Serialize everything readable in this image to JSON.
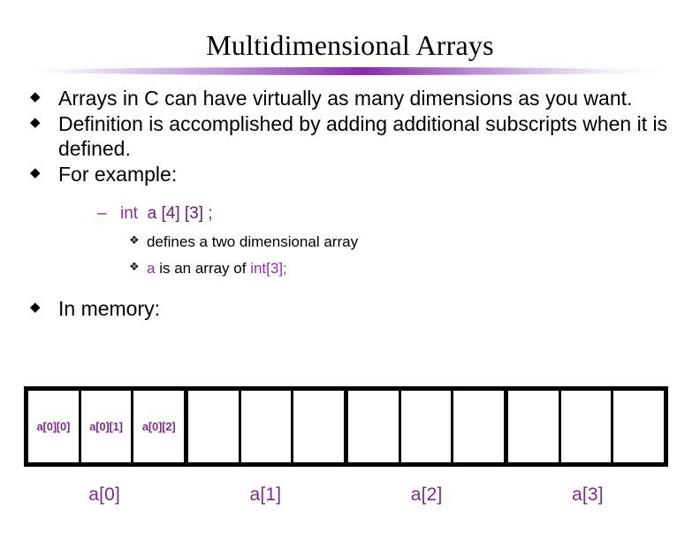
{
  "slide": {
    "title": "Multidimensional Arrays",
    "bullet_marker": "◆",
    "dash_marker": "–",
    "diamond_marker": "❖"
  },
  "bullets": [
    {
      "text": "Arrays in C can have virtually as many dimensions as you want."
    },
    {
      "text": "Definition is accomplished by adding additional subscripts when it is defined."
    },
    {
      "text": "For example:"
    }
  ],
  "code_line": {
    "keyword": "int",
    "expression": "a [4] [3] ;"
  },
  "sub_points": [
    {
      "prefix": "",
      "emphasis": "",
      "text": "defines a two dimensional array",
      "suffix": ""
    },
    {
      "prefix": "",
      "emphasis": "a",
      "text": " is an array of ",
      "suffix": "int[3];"
    }
  ],
  "memory_bullet": {
    "text": "In memory:"
  },
  "memory": {
    "groups": [
      {
        "label": "a[0]",
        "cells": [
          "a[0][0]",
          "a[0][1]",
          "a[0][2]"
        ]
      },
      {
        "label": "a[1]",
        "cells": [
          "",
          "",
          ""
        ]
      },
      {
        "label": "a[2]",
        "cells": [
          "",
          "",
          ""
        ]
      },
      {
        "label": "a[3]",
        "cells": [
          "",
          "",
          ""
        ]
      }
    ]
  },
  "colors": {
    "accent_purple": "#7B2D8E",
    "bright_purple": "#8F2FAF",
    "rule_purple": "#8C28B4",
    "text_black": "#000000"
  }
}
